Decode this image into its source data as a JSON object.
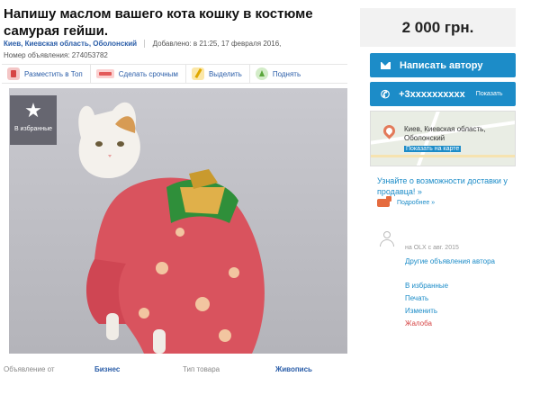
{
  "ad": {
    "title": "Напишу маслом вашего кота кошку в костюме самурая гейши.",
    "location": "Киев, Киевская область, Оболонский",
    "added": "Добавлено: в 21:25, 17 февраля 2016,",
    "ad_number": "Номер объявления: 274053782"
  },
  "actions": {
    "top": "Разместить в Топ",
    "urgent": "Сделать срочным",
    "highlight": "Выделить",
    "raise": "Поднять"
  },
  "photo": {
    "favorites": "В избранные"
  },
  "attributes": {
    "offer_from_label": "Объявление от",
    "offer_from_value": "Бизнес",
    "type_label": "Тип товара",
    "type_value": "Живопись"
  },
  "sidebar": {
    "price": "2 000 грн.",
    "write_author": "Написать автору",
    "phone": "+3xxxxxxxxxx",
    "show_phone": "Показать",
    "map_location": "Киев, Киевская область, Оболонский",
    "show_on_map": "Показать на карте",
    "delivery_link": "Узнайте о возможности доставки у продавца! »",
    "more": "Подробнее »",
    "member_since": "на OLX с авг. 2015",
    "other_ads": "Другие объявления автора",
    "to_favorites": "В избранные",
    "print": "Печать",
    "edit": "Изменить",
    "complaint": "Жалоба"
  },
  "colors": {
    "accent": "#1c8cc8",
    "link": "#2a5da8",
    "danger": "#d64545"
  }
}
